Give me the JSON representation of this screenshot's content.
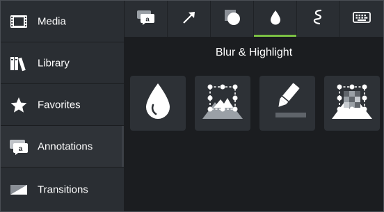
{
  "sidebar": {
    "items": [
      {
        "label": "Media",
        "icon": "film-strip-icon"
      },
      {
        "label": "Library",
        "icon": "books-icon"
      },
      {
        "label": "Favorites",
        "icon": "star-icon"
      },
      {
        "label": "Annotations",
        "icon": "annotation-bubble-icon"
      },
      {
        "label": "Transitions",
        "icon": "transition-icon"
      }
    ],
    "active_index": 3
  },
  "tabs": [
    {
      "icon": "callout-icon",
      "glyph": "a"
    },
    {
      "icon": "arrow-icon"
    },
    {
      "icon": "shape-icon"
    },
    {
      "icon": "blur-highlight-drop-icon"
    },
    {
      "icon": "sketch-motion-icon"
    },
    {
      "icon": "keyboard-callout-icon"
    }
  ],
  "active_tab_index": 3,
  "section": {
    "title": "Blur & Highlight"
  },
  "tiles": [
    {
      "icon": "blur-drop-icon"
    },
    {
      "icon": "spotlight-icon"
    },
    {
      "icon": "highlight-pen-icon"
    },
    {
      "icon": "pixelate-icon"
    }
  ],
  "colors": {
    "accent": "#7bc043",
    "sidebar_bg": "#2a2e33",
    "panel_bg": "#1b1d20",
    "tile_bg": "#2d3136"
  }
}
